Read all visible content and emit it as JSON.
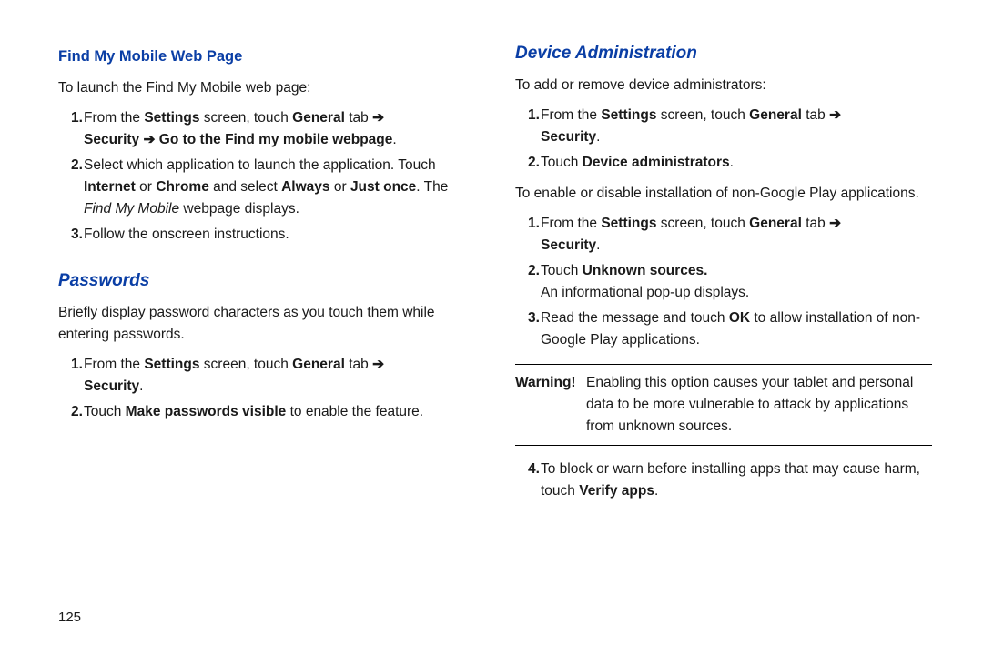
{
  "left": {
    "h3": "Find My Mobile Web Page",
    "intro": "To launch the Find My Mobile web page:",
    "steps1": [
      {
        "n": "1.",
        "pre": "From the ",
        "b1": "Settings",
        "mid1": " screen, touch ",
        "b2": "General",
        "mid2": " tab ",
        "arrow": "➔",
        "br": true,
        "b3": "Security ➔ Go to the Find my mobile webpage",
        "post": "."
      },
      {
        "n": "2.",
        "text1": "Select which application to launch the application. Touch ",
        "b1": "Internet",
        "mid1": " or ",
        "b2": "Chrome",
        "mid2": " and select ",
        "b3": "Always",
        "mid3": " or ",
        "b4": "Just once",
        "mid4": ". The ",
        "i1": "Find My Mobile",
        "post": " webpage displays."
      },
      {
        "n": "3.",
        "plain": "Follow the onscreen instructions."
      }
    ],
    "h2": "Passwords",
    "pw_intro": "Briefly display password characters as you touch them while entering passwords.",
    "steps2": [
      {
        "n": "1.",
        "pre": "From the ",
        "b1": "Settings",
        "mid1": " screen, touch ",
        "b2": "General",
        "mid2": " tab ",
        "arrow": "➔",
        "br": true,
        "b3": "Security",
        "post": "."
      },
      {
        "n": "2.",
        "pre": "Touch ",
        "b1": "Make passwords visible",
        "post": " to enable the feature."
      }
    ],
    "page": "125"
  },
  "right": {
    "h2": "Device Administration",
    "intro1": "To add or remove device administrators:",
    "steps1": [
      {
        "n": "1.",
        "pre": "From the ",
        "b1": "Settings",
        "mid1": " screen, touch ",
        "b2": "General",
        "mid2": " tab ",
        "arrow": "➔",
        "br": true,
        "b3": "Security",
        "post": "."
      },
      {
        "n": "2.",
        "pre": "Touch ",
        "b1": "Device administrators",
        "post": "."
      }
    ],
    "intro2": "To enable or disable installation of non-Google Play applications.",
    "steps2": [
      {
        "n": "1.",
        "pre": "From the ",
        "b1": "Settings",
        "mid1": " screen, touch ",
        "b2": "General",
        "mid2": " tab ",
        "arrow": "➔",
        "br": true,
        "b3": "Security",
        "post": "."
      },
      {
        "n": "2.",
        "pre": "Touch ",
        "b1": "Unknown sources.",
        "br2": true,
        "post2": "An informational pop-up displays."
      },
      {
        "n": "3.",
        "pre": "Read the message and touch ",
        "b1": "OK",
        "post": " to allow installation of non-Google Play applications."
      }
    ],
    "warning_label": "Warning!",
    "warning_text": " Enabling this option causes your tablet and personal data to be more vulnerable to attack by applications from unknown sources.",
    "steps3": [
      {
        "n": "4.",
        "pre": "To block or warn before installing apps that may cause harm, touch ",
        "b1": "Verify apps",
        "post": "."
      }
    ]
  }
}
